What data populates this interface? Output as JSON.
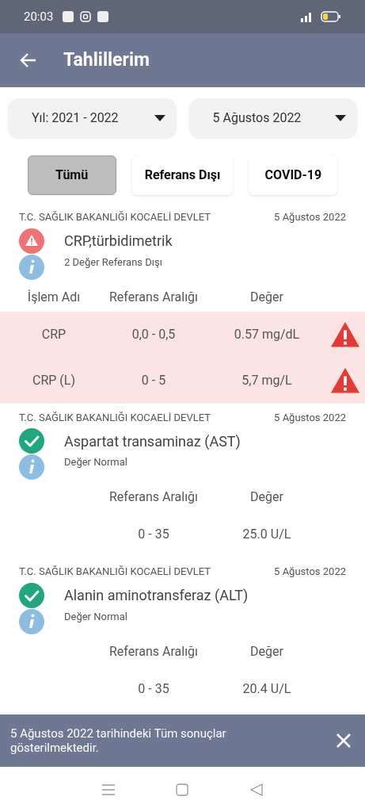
{
  "status_bar": {
    "time": "20:03"
  },
  "app_bar": {
    "title": "Tahlillerim"
  },
  "filters": [
    {
      "label": "Yıl: 2021 - 2022"
    },
    {
      "label": "5 Ağustos 2022"
    }
  ],
  "tabs": [
    {
      "label": "Tümü",
      "selected": true
    },
    {
      "label": "Referans Dışı",
      "selected": false
    },
    {
      "label": "COVID-19",
      "selected": false
    }
  ],
  "results": [
    {
      "kind": "out_of_range",
      "institution": "T.C. SAĞLIK BAKANLIĞI KOCAELİ DEVLET",
      "date": "5 Ağustos 2022",
      "name": "CRP,türbidimetrik",
      "info": "2 Değer Referans Dışı",
      "columns": [
        {
          "kind": "name",
          "label": "İşlem Adı"
        },
        {
          "kind": "range",
          "label": "Referans Aralığı"
        },
        {
          "kind": "value",
          "label": "Değer"
        }
      ],
      "rows": [
        {
          "name": "CRP",
          "range": "0,0 - 0,5",
          "value": "0.57 mg/dL",
          "flagged": true
        },
        {
          "name": "CRP (L)",
          "range": "0 - 5",
          "value": "5,7 mg/L",
          "flagged": true
        }
      ]
    },
    {
      "kind": "normal",
      "institution": "T.C. SAĞLIK BAKANLIĞI KOCAELİ DEVLET",
      "date": "5 Ağustos 2022",
      "name": "Aspartat transaminaz (AST)",
      "info": "Değer Normal",
      "columns": [
        {
          "kind": "range",
          "label": "Referans Aralığı"
        },
        {
          "kind": "value",
          "label": "Değer"
        }
      ],
      "rows": [
        {
          "range": "0 - 35",
          "value": "25.0 U/L",
          "flagged": false
        }
      ]
    },
    {
      "kind": "normal",
      "institution": "T.C. SAĞLIK BAKANLIĞI KOCAELİ DEVLET",
      "date": "5 Ağustos 2022",
      "name": "Alanin aminotransferaz (ALT)",
      "info": "Değer Normal",
      "columns": [
        {
          "kind": "range",
          "label": "Referans Aralığı"
        },
        {
          "kind": "value",
          "label": "Değer"
        }
      ],
      "rows": [
        {
          "range": "0 - 35",
          "value": "20.4 U/L",
          "flagged": false
        }
      ]
    }
  ],
  "snackbar": {
    "message": "5 Ağustos 2022 tarihindeki Tüm sonuçlar gösterilmektedir."
  }
}
